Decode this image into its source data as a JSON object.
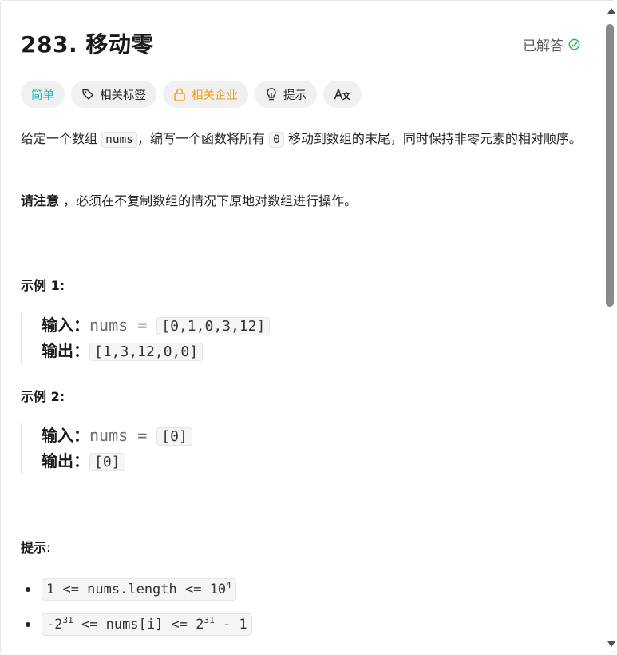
{
  "problem": {
    "title": "283. 移动零",
    "status": "已解答"
  },
  "tags": {
    "difficulty": "简单",
    "related_tags": "相关标签",
    "related_companies": "相关企业",
    "hint": "提示",
    "translate_icon": "translate-icon"
  },
  "description": {
    "part1": "给定一个数组 ",
    "code1": "nums",
    "part2": "，编写一个函数将所有 ",
    "code2": "0",
    "part3": " 移动到数组的末尾，同时保持非零元素的相对顺序。",
    "note_bold": "请注意",
    "note_rest": " ，必须在不复制数组的情况下原地对数组进行操作。"
  },
  "examples": [
    {
      "title": "示例 1:",
      "input_label": "输入：",
      "input_var": "nums = ",
      "input_value": "[0,1,0,3,12]",
      "output_label": "输出：",
      "output_value": "[1,3,12,0,0]"
    },
    {
      "title": "示例 2:",
      "input_label": "输入：",
      "input_var": "nums = ",
      "input_value": "[0]",
      "output_label": "输出：",
      "output_value": "[0]"
    }
  ],
  "hints": {
    "title": "提示",
    "colon": ":",
    "c1_a": "1 <= nums.length <= 10",
    "c1_sup": "4",
    "c2_a": "-2",
    "c2_sup1": "31",
    "c2_b": " <= nums[i] <= 2",
    "c2_sup2": "31",
    "c2_c": " - 1"
  },
  "colors": {
    "easy": "#1cb8b8",
    "company": "#f0a020",
    "solved_check": "#2db55d"
  }
}
